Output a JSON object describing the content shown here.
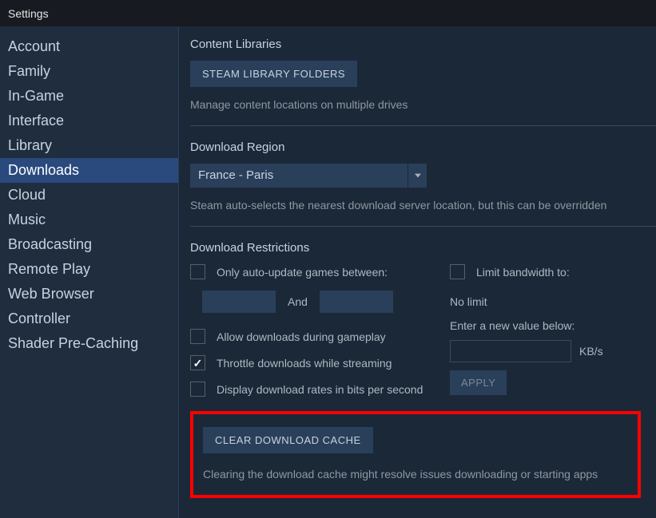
{
  "header": {
    "title": "Settings"
  },
  "sidebar": {
    "items": [
      {
        "label": "Account"
      },
      {
        "label": "Family"
      },
      {
        "label": "In-Game"
      },
      {
        "label": "Interface"
      },
      {
        "label": "Library"
      },
      {
        "label": "Downloads",
        "active": true
      },
      {
        "label": "Cloud"
      },
      {
        "label": "Music"
      },
      {
        "label": "Broadcasting"
      },
      {
        "label": "Remote Play"
      },
      {
        "label": "Web Browser"
      },
      {
        "label": "Controller"
      },
      {
        "label": "Shader Pre-Caching"
      }
    ]
  },
  "libraries": {
    "title": "Content Libraries",
    "button": "STEAM LIBRARY FOLDERS",
    "desc": "Manage content locations on multiple drives"
  },
  "region": {
    "title": "Download Region",
    "value": "France - Paris",
    "desc": "Steam auto-selects the nearest download server location, but this can be overridden"
  },
  "restrictions": {
    "title": "Download Restrictions",
    "auto_update": "Only auto-update games between:",
    "and": "And",
    "allow_gameplay": "Allow downloads during gameplay",
    "throttle_streaming": "Throttle downloads while streaming",
    "bits_per_second": "Display download rates in bits per second",
    "limit_bandwidth": "Limit bandwidth to:",
    "no_limit": "No limit",
    "enter_value": "Enter a new value below:",
    "kbs": "KB/s",
    "apply": "APPLY"
  },
  "cache": {
    "button": "CLEAR DOWNLOAD CACHE",
    "desc": "Clearing the download cache might resolve issues downloading or starting apps"
  }
}
